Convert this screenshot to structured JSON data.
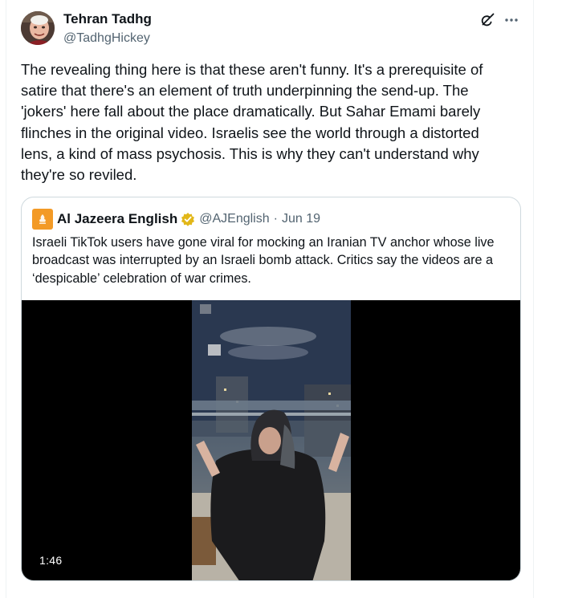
{
  "tweet": {
    "author": {
      "display_name": "Tehran Tadhg",
      "handle": "@TadhgHickey",
      "avatar": "avatar-photo"
    },
    "header_icons": [
      "grok-icon",
      "more-options-icon"
    ],
    "text": "The revealing thing here is that these aren't funny. It's a prerequisite of satire that there's an element of truth underpinning the send-up. The 'jokers' here fall about the place dramatically. But Sahar Emami barely flinches in the original video. Israelis see the world through a distorted lens, a kind of mass psychosis. This is why they can't understand why they're so reviled."
  },
  "quoted": {
    "display_name": "Al Jazeera English",
    "verified_badge": "gold-verified-badge-icon",
    "handle": "@AJEnglish",
    "separator": "·",
    "date": "Jun 19",
    "text": "Israeli TikTok users have gone viral for mocking an Iranian TV anchor whose live broadcast was interrupted by an Israeli bomb attack. Critics say the videos are a ‘despicable’ celebration of war crimes.",
    "video": {
      "duration": "1:46"
    }
  },
  "colors": {
    "text_primary": "#0f1419",
    "text_secondary": "#536471",
    "border": "#cfd9de",
    "aj_brand": "#f39a26",
    "verified_gold": "#e2b719"
  }
}
